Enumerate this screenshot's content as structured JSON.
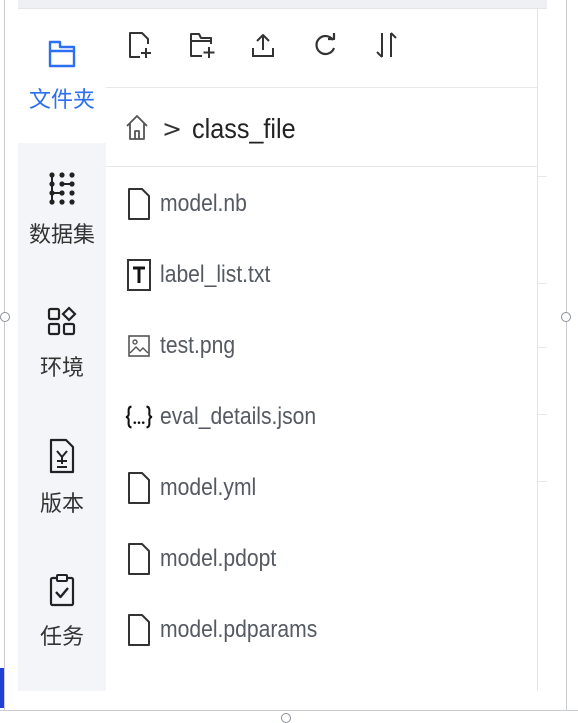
{
  "sidebar": {
    "items": [
      {
        "label": "文件夹",
        "icon": "folder-icon",
        "active": true
      },
      {
        "label": "数据集",
        "icon": "dataset-grid-icon",
        "active": false
      },
      {
        "label": "环境",
        "icon": "apps-icon",
        "active": false
      },
      {
        "label": "版本",
        "icon": "version-doc-icon",
        "active": false
      },
      {
        "label": "任务",
        "icon": "clipboard-check-icon",
        "active": false
      }
    ]
  },
  "toolbar": {
    "buttons": [
      {
        "icon": "new-file-icon"
      },
      {
        "icon": "new-folder-icon"
      },
      {
        "icon": "upload-icon"
      },
      {
        "icon": "refresh-icon"
      },
      {
        "icon": "sort-icon"
      }
    ]
  },
  "breadcrumb": {
    "separator": ">",
    "current": "class_file"
  },
  "files": [
    {
      "name": "model.nb",
      "icon": "file-icon"
    },
    {
      "name": "label_list.txt",
      "icon": "text-file-icon"
    },
    {
      "name": "test.png",
      "icon": "image-file-icon"
    },
    {
      "name": "eval_details.json",
      "icon": "json-file-icon"
    },
    {
      "name": "model.yml",
      "icon": "file-icon"
    },
    {
      "name": "model.pdopt",
      "icon": "file-icon"
    },
    {
      "name": "model.pdparams",
      "icon": "file-icon"
    }
  ],
  "colors": {
    "accent": "#2b6ff2",
    "text": "#333333",
    "file_text": "#555a62",
    "sidebar_bg": "#f3f5f8"
  }
}
